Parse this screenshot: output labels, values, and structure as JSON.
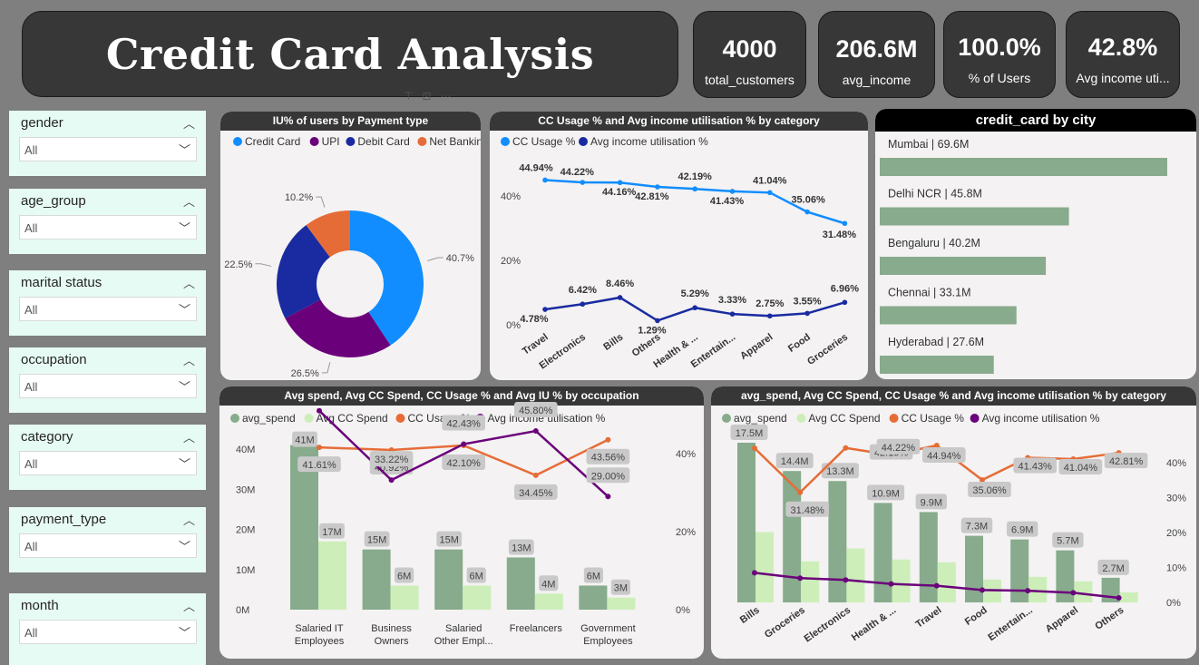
{
  "title": "Credit Card Analysis",
  "kpis": [
    {
      "value": "4000",
      "label": "total_customers"
    },
    {
      "value": "206.6M",
      "label": "avg_income"
    },
    {
      "value": "100.0%",
      "label": "% of Users"
    },
    {
      "value": "42.8%",
      "label": "Avg income uti..."
    }
  ],
  "filters": [
    {
      "label": "gender",
      "value": "All"
    },
    {
      "label": "age_group",
      "value": "All"
    },
    {
      "label": "marital status",
      "value": "All"
    },
    {
      "label": "occupation",
      "value": "All"
    },
    {
      "label": "category",
      "value": "All"
    },
    {
      "label": "payment_type",
      "value": "All"
    },
    {
      "label": "month",
      "value": "All"
    }
  ],
  "colors": {
    "credit_card": "#118dff",
    "upi": "#6b007b",
    "debit_card": "#1a2ba1",
    "net_banking": "#e66c37",
    "avg_spend": "#87ab8c",
    "avg_cc_spend": "#cdeeb9",
    "cc_usage": "#e66c37",
    "avg_income_util": "#6b007b",
    "cc_line": "#118dff",
    "iu_line": "#1a2ba1",
    "city_bar": "#87ab8c"
  },
  "charts": {
    "payment": {
      "title": "IU% of users by Payment type",
      "legend": [
        "Credit Card",
        "UPI",
        "Debit Card",
        "Net Banking"
      ],
      "chart_data": {
        "type": "pie",
        "categories": [
          "Credit Card",
          "UPI",
          "Debit Card",
          "Net Banking"
        ],
        "values": [
          40.7,
          26.5,
          22.5,
          10.2
        ],
        "labels": [
          "40.7%",
          "26.5%",
          "22.5%",
          "10.2%"
        ]
      }
    },
    "cc_category": {
      "title": "CC Usage % and Avg income utilisation % by category",
      "legend": [
        "CC Usage %",
        "Avg income utilisation %"
      ],
      "y_ticks": [
        "40%",
        "20%",
        "0%"
      ],
      "chart_data": {
        "type": "line",
        "categories": [
          "Travel",
          "Electronics",
          "Bills",
          "Others",
          "Health & ...",
          "Entertain...",
          "Apparel",
          "Food",
          "Groceries"
        ],
        "series": [
          {
            "name": "CC Usage %",
            "values": [
              44.94,
              44.22,
              44.16,
              42.81,
              42.19,
              41.43,
              41.04,
              35.06,
              31.48
            ]
          },
          {
            "name": "Avg income utilisation %",
            "values": [
              4.78,
              6.42,
              8.46,
              1.29,
              5.29,
              3.33,
              2.75,
              3.55,
              6.96
            ]
          }
        ],
        "series_labels": [
          [
            "44.94%",
            "44.22%",
            "44.16%",
            "42.81%",
            "42.19%",
            "41.43%",
            "41.04%",
            "35.06%",
            "31.48%"
          ],
          [
            "4.78%",
            "6.42%",
            "8.46%",
            "1.29%",
            "5.29%",
            "3.33%",
            "2.75%",
            "3.55%",
            "6.96%"
          ]
        ],
        "ylim": [
          0,
          50
        ]
      }
    },
    "city": {
      "title": "credit_card by city",
      "chart_data": {
        "type": "bar",
        "categories": [
          "Mumbai",
          "Delhi NCR",
          "Bengaluru",
          "Chennai",
          "Hyderabad"
        ],
        "values": [
          69.6,
          45.8,
          40.2,
          33.1,
          27.6
        ],
        "labels": [
          "Mumbai | 69.6M",
          "Delhi NCR | 45.8M",
          "Bengaluru | 40.2M",
          "Chennai | 33.1M",
          "Hyderabad | 27.6M"
        ]
      }
    },
    "occupation": {
      "title": "Avg spend, Avg CC Spend, CC Usage % and Avg IU % by occupation",
      "legend": [
        "avg_spend",
        "Avg CC Spend",
        "CC Usage %",
        "Avg income utilisation %"
      ],
      "y_left": [
        "40M",
        "30M",
        "20M",
        "10M",
        "0M"
      ],
      "y_right": [
        "40%",
        "20%",
        "0%"
      ],
      "chart_data": {
        "type": "bar",
        "categories": [
          [
            "Salaried IT",
            "Employees"
          ],
          [
            "Business",
            "Owners"
          ],
          [
            "Salaried",
            "Other Empl..."
          ],
          [
            "Freelancers",
            ""
          ],
          [
            "Government",
            "Employees"
          ]
        ],
        "series": [
          {
            "name": "avg_spend",
            "values": [
              41,
              15,
              15,
              13,
              6
            ]
          },
          {
            "name": "Avg CC Spend",
            "values": [
              17,
              6,
              6,
              4,
              3
            ]
          },
          {
            "name": "CC Usage %",
            "values": [
              41.61,
              40.92,
              42.1,
              34.45,
              43.56
            ]
          },
          {
            "name": "Avg income utilisation %",
            "values": [
              51.0,
              33.22,
              42.43,
              45.8,
              29.0
            ]
          }
        ],
        "bar_labels": [
          [
            "41M",
            "15M",
            "15M",
            "13M",
            "6M"
          ],
          [
            "17M",
            "6M",
            "6M",
            "4M",
            "3M"
          ]
        ],
        "line_labels": [
          [
            "41.61%",
            "40.92%",
            "42.10%",
            "34.45%",
            "43.56%"
          ],
          [
            "",
            "33.22%",
            "42.43%",
            "45.80%",
            "29.00%"
          ]
        ],
        "ylim": [
          0,
          45
        ]
      }
    },
    "cat_combo": {
      "title": "avg_spend, Avg CC Spend, CC Usage % and Avg income utilisation % by category",
      "legend": [
        "avg_spend",
        "Avg CC Spend",
        "CC Usage %",
        "Avg income utilisation %"
      ],
      "y_right": [
        "40%",
        "30%",
        "20%",
        "10%",
        "0%"
      ],
      "chart_data": {
        "type": "bar",
        "categories": [
          "Bills",
          "Groceries",
          "Electronics",
          "Health & ...",
          "Travel",
          "Food",
          "Entertain...",
          "Apparel",
          "Others"
        ],
        "series": [
          {
            "name": "avg_spend",
            "values": [
              17.5,
              14.4,
              13.3,
              10.9,
              9.9,
              7.3,
              6.9,
              5.7,
              2.7
            ]
          },
          {
            "name": "Avg CC Spend",
            "values": [
              7.7,
              4.5,
              5.9,
              4.7,
              4.4,
              2.5,
              2.8,
              2.3,
              1.1
            ]
          },
          {
            "name": "CC Usage %",
            "values": [
              44.16,
              31.48,
              44.22,
              42.19,
              44.94,
              35.06,
              41.43,
              41.04,
              42.81
            ]
          },
          {
            "name": "Avg income utilisation %",
            "values": [
              8.46,
              6.96,
              6.42,
              5.29,
              4.78,
              3.55,
              3.33,
              2.75,
              1.29
            ]
          }
        ],
        "bar_labels": [
          "17.5M",
          "14.4M",
          "13.3M",
          "10.9M",
          "9.9M",
          "7.3M",
          "6.9M",
          "5.7M",
          "2.7M"
        ],
        "line_labels": [
          "",
          "31.48%",
          "",
          "42.19%",
          "44.94%",
          "35.06%",
          "41.43%",
          "41.04%",
          "42.81%"
        ],
        "extra_label": "44.22%",
        "ylim": [
          0,
          50
        ]
      }
    }
  }
}
